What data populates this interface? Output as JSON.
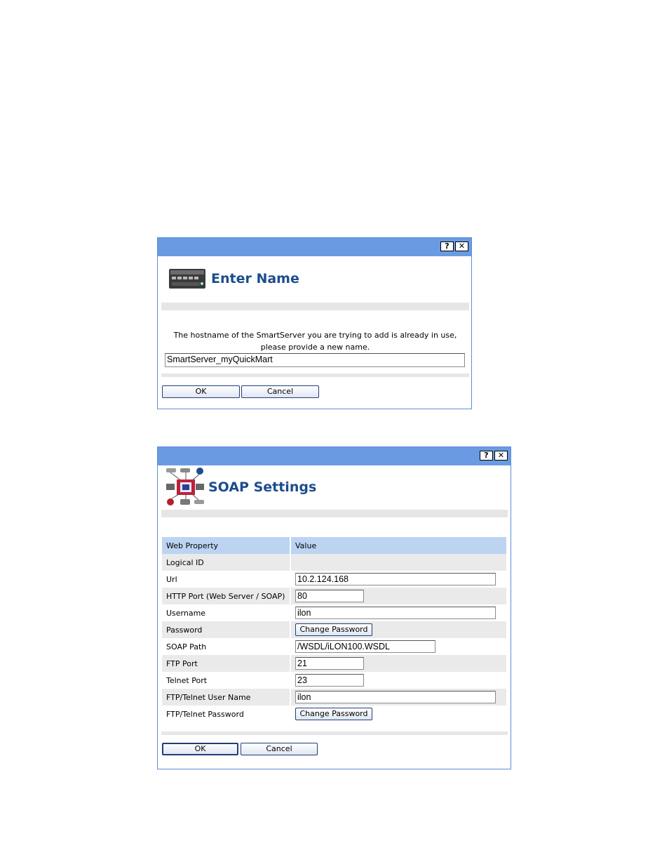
{
  "enter_name_dialog": {
    "help_label": "?",
    "close_label": "✕",
    "title": "Enter Name",
    "message": "The hostname of the SmartServer you are trying to add is already in use, please provide a new name.",
    "name_value": "SmartServer_myQuickMart",
    "ok_label": "OK",
    "cancel_label": "Cancel"
  },
  "soap_dialog": {
    "help_label": "?",
    "close_label": "✕",
    "title": "SOAP Settings",
    "columns": [
      "Web Property",
      "Value"
    ],
    "rows": [
      {
        "property": "Logical ID",
        "value": ""
      },
      {
        "property": "Url",
        "value": "10.2.124.168"
      },
      {
        "property": "HTTP Port (Web Server / SOAP)",
        "value": "80"
      },
      {
        "property": "Username",
        "value": "ilon"
      },
      {
        "property": "Password",
        "button": "Change Password"
      },
      {
        "property": "SOAP Path",
        "value": "/WSDL/iLON100.WSDL"
      },
      {
        "property": "FTP Port",
        "value": "21"
      },
      {
        "property": "Telnet Port",
        "value": "23"
      },
      {
        "property": "FTP/Telnet User Name",
        "value": "ilon"
      },
      {
        "property": "FTP/Telnet Password",
        "button": "Change Password"
      }
    ],
    "ok_label": "OK",
    "cancel_label": "Cancel"
  },
  "colors": {
    "titlebar": "#6a9be2",
    "header_text": "#1c4d8c",
    "table_header": "#bcd4f2",
    "row_alt": "#eaeaea"
  }
}
